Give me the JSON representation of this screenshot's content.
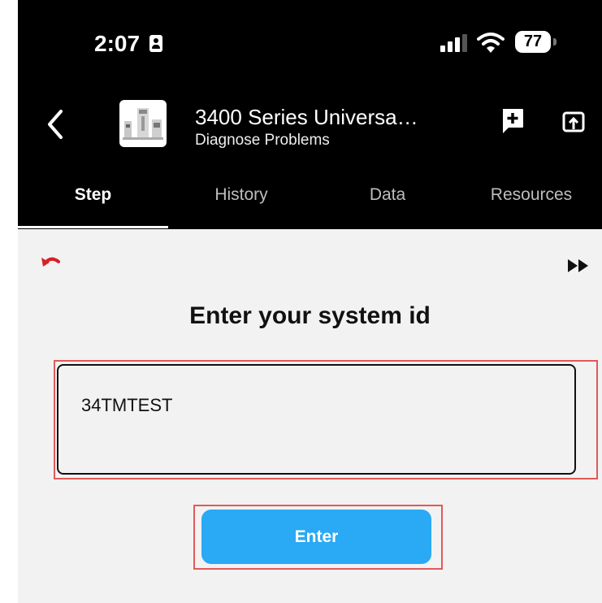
{
  "status_bar": {
    "time": "2:07",
    "battery": "77"
  },
  "header": {
    "title": "3400 Series Universa…",
    "subtitle": "Diagnose Problems"
  },
  "tabs": [
    {
      "label": "Step",
      "active": true
    },
    {
      "label": "History",
      "active": false
    },
    {
      "label": "Data",
      "active": false
    },
    {
      "label": "Resources",
      "active": false
    }
  ],
  "step": {
    "heading": "Enter your system id",
    "input_value": "34TMTEST",
    "enter_label": "Enter"
  },
  "colors": {
    "accent_button": "#2aa9f4",
    "undo_icon": "#d61f26",
    "highlight": "#e15959"
  }
}
